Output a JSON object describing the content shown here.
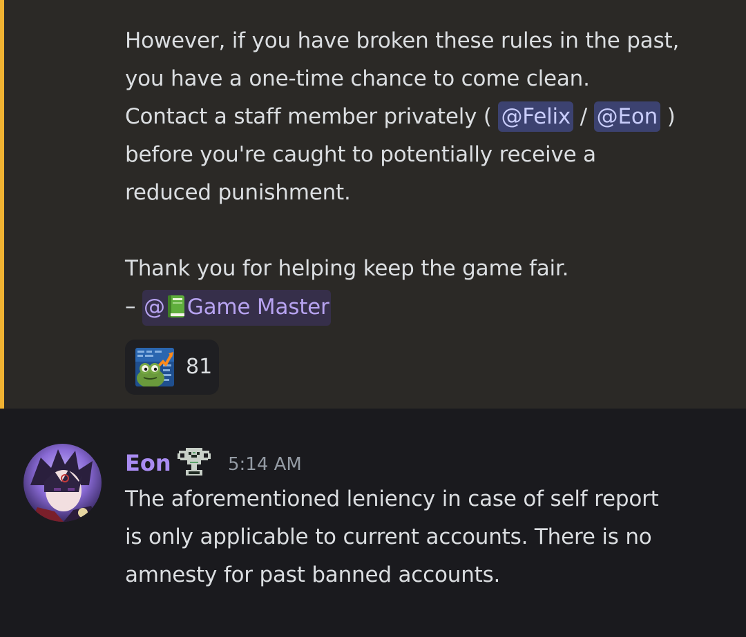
{
  "highlighted_message": {
    "lines_before": [
      "However, if you have broken these rules in the past,",
      "you have a one-time chance to come clean."
    ],
    "contact_line": {
      "prefix": "Contact a staff member privately ( ",
      "mention_1": "@Felix",
      "separator": " / ",
      "mention_2": "@Eon",
      "suffix": " )"
    },
    "lines_after": [
      "before you're caught to potentially receive a",
      "reduced punishment."
    ],
    "closing_line": "Thank you for helping keep the game fair.",
    "signature": {
      "prefix": "– ",
      "role_at": "@",
      "role_name": "Game Master",
      "role_icon": "green-book-icon"
    },
    "reaction": {
      "emoji": "frog-stocks-emoji",
      "count": "81"
    },
    "accent_color": "#f0b232"
  },
  "message": {
    "author": "Eon",
    "author_color": "#a98cf2",
    "badge_icon": "trophy-icon",
    "timestamp": "5:14 AM",
    "lines": [
      "The aforementioned leniency in case of self report",
      "is only applicable to current accounts. There is no",
      "amnesty for past banned accounts."
    ]
  }
}
